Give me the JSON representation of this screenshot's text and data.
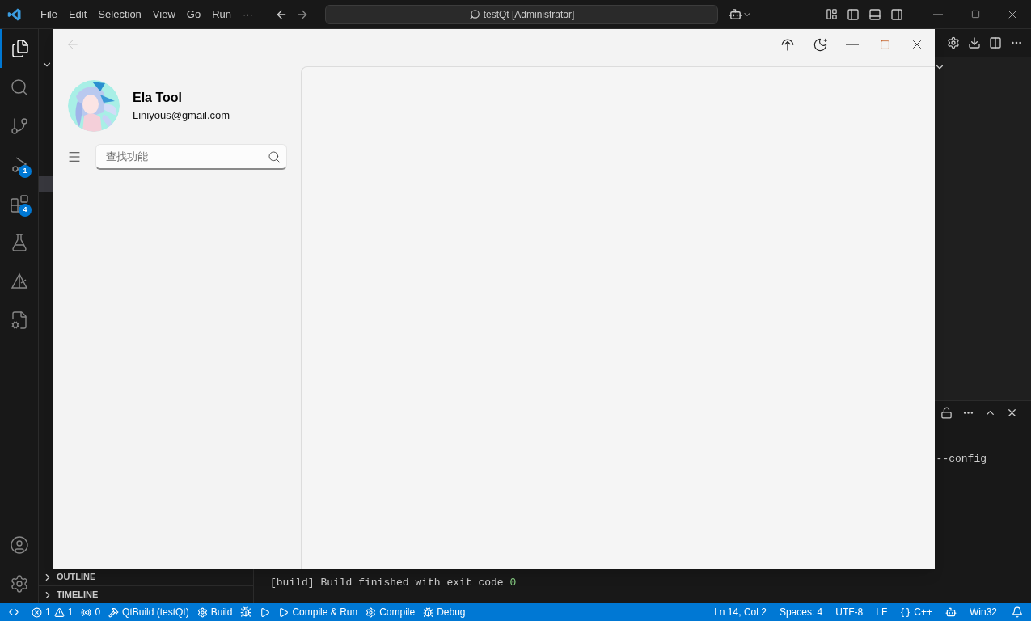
{
  "vscode": {
    "menu": [
      "File",
      "Edit",
      "Selection",
      "View",
      "Go",
      "Run",
      "···"
    ],
    "command_center": "testQt [Administrator]",
    "activity_bar": [
      {
        "selected": true
      },
      {
        "selected": false
      },
      {
        "selected": false
      },
      {
        "selected": false,
        "badge": "1"
      },
      {
        "selected": false,
        "badge": "4"
      },
      {
        "selected": false
      },
      {
        "selected": false
      },
      {
        "selected": false
      }
    ],
    "sidebar_sections": [
      {
        "label": "OUTLINE",
        "expanded": false
      },
      {
        "label": "TIMELINE",
        "expanded": false
      }
    ],
    "terminal": {
      "line_1": "--config",
      "line_2": "[build] Build finished with exit code ",
      "exit_code": "0"
    },
    "status_bar": {
      "errors": "1",
      "warnings": "1",
      "ports": "0",
      "tasks_left": [
        "QtBuild (testQt)",
        "Build"
      ],
      "tasks_right": [
        "Compile & Run",
        "Compile",
        "Debug"
      ],
      "right": [
        "Ln 14, Col 2",
        "Spaces: 4",
        "UTF-8",
        "LF"
      ],
      "language": "C++",
      "platform": "Win32"
    }
  },
  "app_window": {
    "back": {
      "disabled": true
    },
    "user": {
      "name": "Ela Tool",
      "email": "Liniyous@gmail.com"
    },
    "search": {
      "placeholder": "查找功能"
    }
  }
}
